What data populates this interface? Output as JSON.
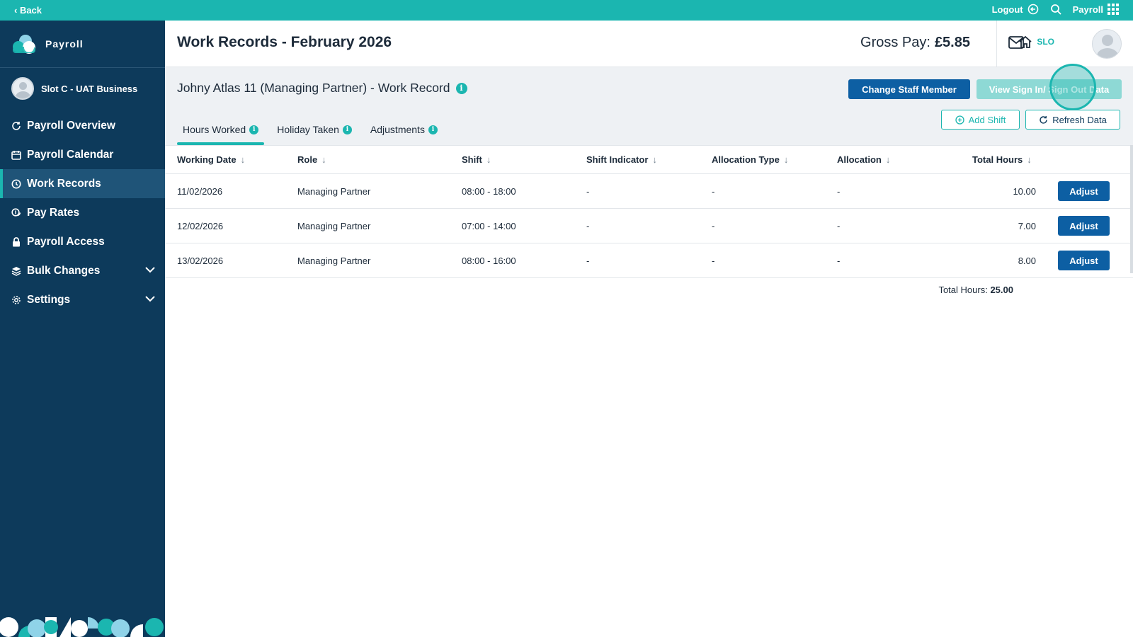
{
  "topbar": {
    "back_label": "‹ Back",
    "logout_label": "Logout",
    "app_label": "Payroll"
  },
  "sidebar": {
    "brand_label": "Payroll",
    "business_name": "Slot C - UAT Business",
    "items": [
      {
        "label": "Payroll Overview",
        "icon": "refresh-icon"
      },
      {
        "label": "Payroll Calendar",
        "icon": "calendar-icon"
      },
      {
        "label": "Work Records",
        "icon": "clock-icon",
        "active": true
      },
      {
        "label": "Pay Rates",
        "icon": "coin-icon"
      },
      {
        "label": "Payroll Access",
        "icon": "lock-icon"
      },
      {
        "label": "Bulk Changes",
        "icon": "layers-icon",
        "expandable": true
      },
      {
        "label": "Settings",
        "icon": "gear-icon",
        "expandable": true
      }
    ]
  },
  "header": {
    "title": "Work Records - February 2026",
    "gross_label": "Gross Pay:",
    "gross_value": "£5.85",
    "home_label": "SLO"
  },
  "record": {
    "title": "Johny Atlas 11 (Managing Partner) - Work Record",
    "change_staff_label": "Change Staff Member",
    "view_sign_label": "View Sign In/ Sign Out Data",
    "add_shift_label": "Add Shift",
    "refresh_label": "Refresh Data"
  },
  "tabs": [
    {
      "label": "Hours Worked",
      "active": true
    },
    {
      "label": "Holiday Taken"
    },
    {
      "label": "Adjustments"
    }
  ],
  "table": {
    "columns": [
      "Working Date",
      "Role",
      "Shift",
      "Shift Indicator",
      "Allocation Type",
      "Allocation",
      "Total Hours"
    ],
    "rows": [
      [
        "11/02/2026",
        "Managing Partner",
        "08:00 - 18:00",
        "-",
        "-",
        "-",
        "10.00"
      ],
      [
        "12/02/2026",
        "Managing Partner",
        "07:00 - 14:00",
        "-",
        "-",
        "-",
        "7.00"
      ],
      [
        "13/02/2026",
        "Managing Partner",
        "08:00 - 16:00",
        "-",
        "-",
        "-",
        "8.00"
      ]
    ],
    "adjust_label": "Adjust",
    "total_label": "Total Hours:",
    "total_value": "25.00"
  },
  "colors": {
    "accent": "#1bb6b0",
    "sidebar": "#0d3a5b",
    "primary_button": "#0d5fa3"
  }
}
